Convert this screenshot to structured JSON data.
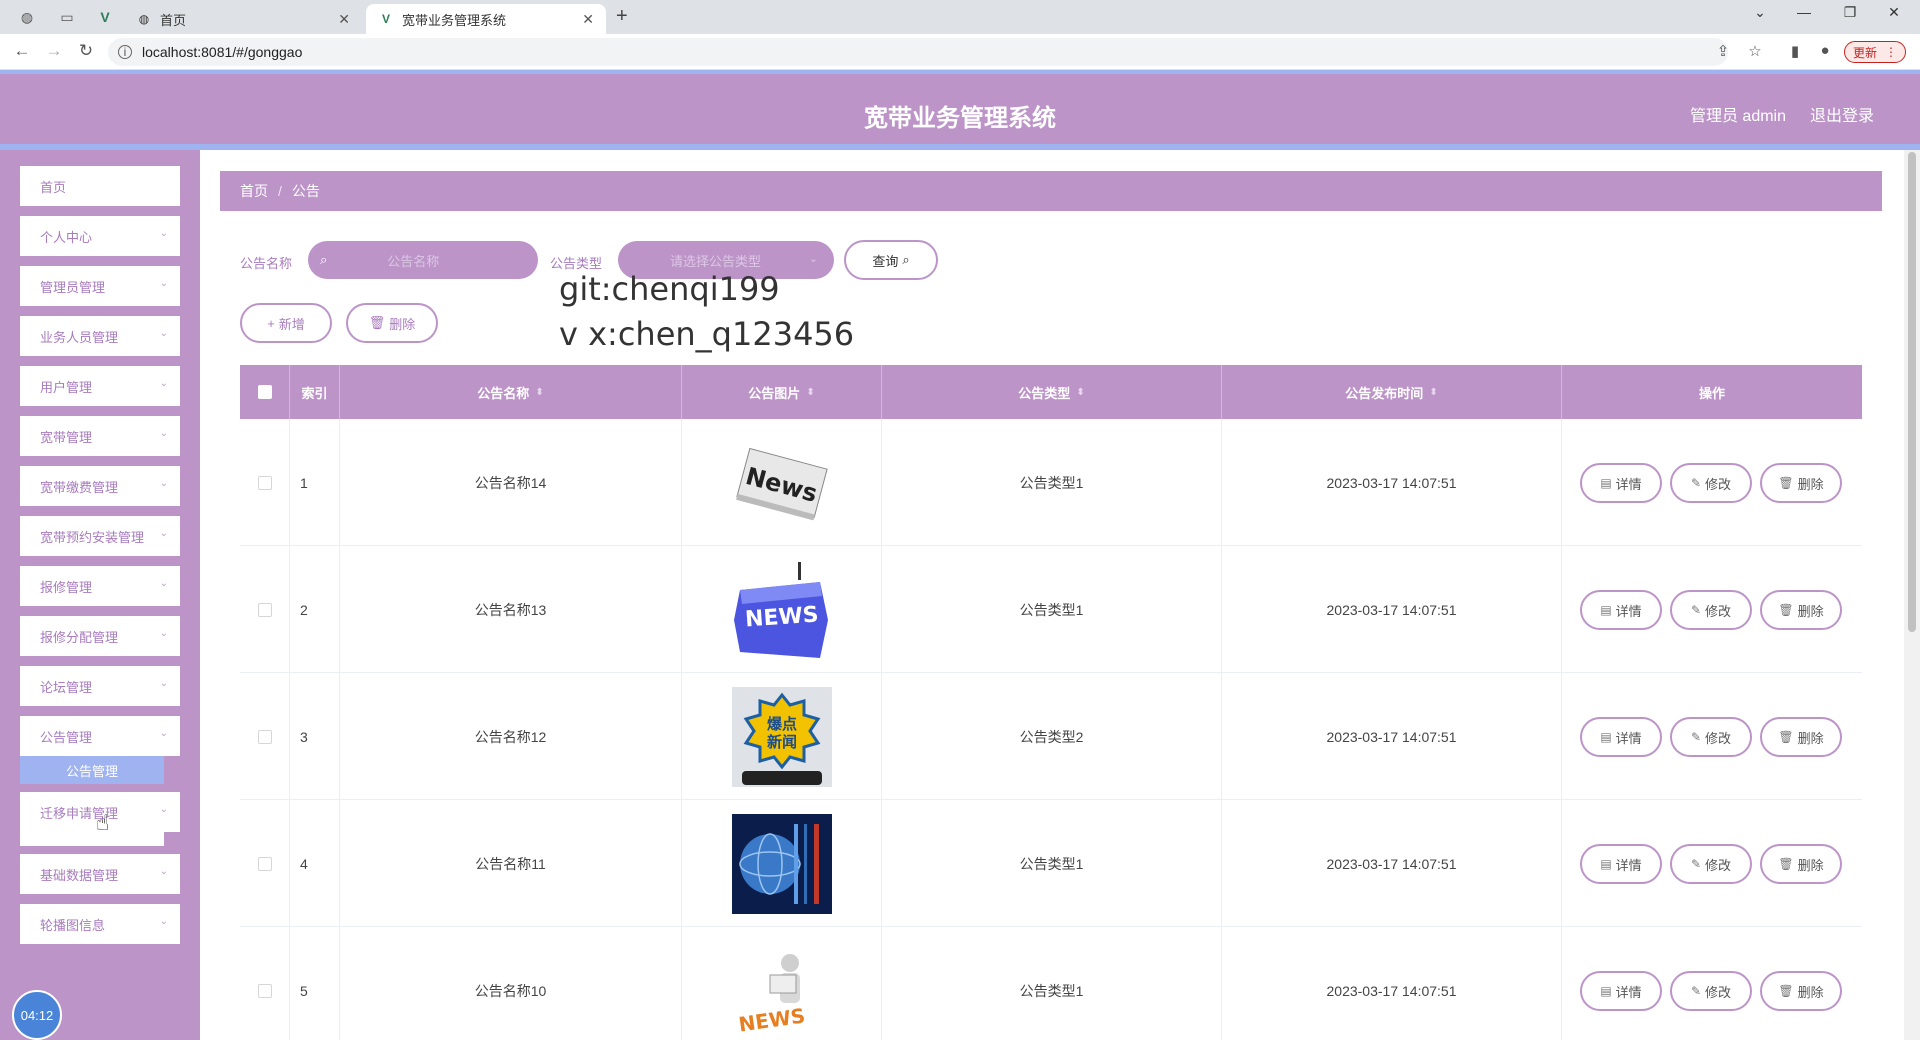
{
  "browser": {
    "tabs": [
      {
        "title": "首页",
        "active": false
      },
      {
        "title": "宽带业务管理系统",
        "active": true
      }
    ],
    "url": "localhost:8081/#/gonggao",
    "update_label": "更新"
  },
  "header": {
    "title": "宽带业务管理系统",
    "user": "管理员 admin",
    "logout": "退出登录"
  },
  "sidebar": {
    "items": [
      {
        "label": "首页"
      },
      {
        "label": "个人中心"
      },
      {
        "label": "管理员管理"
      },
      {
        "label": "业务人员管理"
      },
      {
        "label": "用户管理"
      },
      {
        "label": "宽带管理"
      },
      {
        "label": "宽带缴费管理"
      },
      {
        "label": "宽带预约安装管理"
      },
      {
        "label": "报修管理"
      },
      {
        "label": "报修分配管理"
      },
      {
        "label": "论坛管理"
      },
      {
        "label": "公告管理"
      },
      {
        "label": "迁移申请管理"
      },
      {
        "label": "基础数据管理"
      },
      {
        "label": "轮播图信息"
      }
    ],
    "submenu_label": "公告管理",
    "clock": "04:12"
  },
  "breadcrumb": {
    "home": "首页",
    "sep": "/",
    "current": "公告"
  },
  "search": {
    "name_label": "公告名称",
    "name_placeholder": "公告名称",
    "type_label": "公告类型",
    "type_placeholder": "请选择公告类型",
    "query_label": "查询"
  },
  "toolbar": {
    "add_label": "新增",
    "delete_label": "删除"
  },
  "watermark": {
    "line1": "git:chenqi199",
    "line2": "v x:chen_q123456"
  },
  "table": {
    "headers": {
      "index": "索引",
      "name": "公告名称",
      "image": "公告图片",
      "type": "公告类型",
      "time": "公告发布时间",
      "ops": "操作"
    },
    "rows": [
      {
        "index": "1",
        "name": "公告名称14",
        "type": "公告类型1",
        "time": "2023-03-17 14:07:51",
        "image": "news-newspaper"
      },
      {
        "index": "2",
        "name": "公告名称13",
        "type": "公告类型1",
        "time": "2023-03-17 14:07:51",
        "image": "news-key"
      },
      {
        "index": "3",
        "name": "公告名称12",
        "type": "公告类型2",
        "time": "2023-03-17 14:07:51",
        "image": "breaking-news"
      },
      {
        "index": "4",
        "name": "公告名称11",
        "type": "公告类型1",
        "time": "2023-03-17 14:07:51",
        "image": "globe-news"
      },
      {
        "index": "5",
        "name": "公告名称10",
        "type": "公告类型1",
        "time": "2023-03-17 14:07:51",
        "image": "news-figure"
      }
    ],
    "actions": {
      "detail": "详情",
      "edit": "修改",
      "delete": "删除"
    },
    "thumb_text": {
      "news": "News",
      "news_caps": "NEWS",
      "breaking_1": "爆点",
      "breaking_2": "新闻"
    }
  },
  "colors": {
    "accent": "#bc94c8",
    "accent_blue": "#9fb3f0"
  }
}
